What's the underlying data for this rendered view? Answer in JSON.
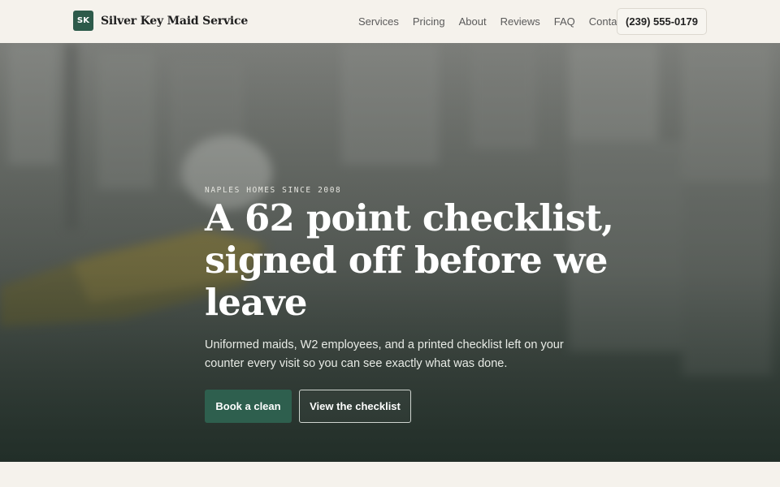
{
  "brand": {
    "logo_text": "SK",
    "name": "Silver Key Maid Service",
    "accent_color": "#2d5a4a"
  },
  "nav": {
    "items": [
      "Services",
      "Pricing",
      "About",
      "Reviews",
      "FAQ",
      "Contact"
    ],
    "phone": "(239) 555-0179"
  },
  "hero": {
    "eyebrow": "NAPLES HOMES SINCE 2008",
    "headline": "A 62 point checklist, signed off before we leave",
    "subtext": "Uniformed maids, W2 employees, and a printed checklist left on your counter every visit so you can see exactly what was done.",
    "primary_cta": "Book a clean",
    "secondary_cta": "View the checklist",
    "background_image": "blurred-bathroom-cleaning-photo"
  }
}
